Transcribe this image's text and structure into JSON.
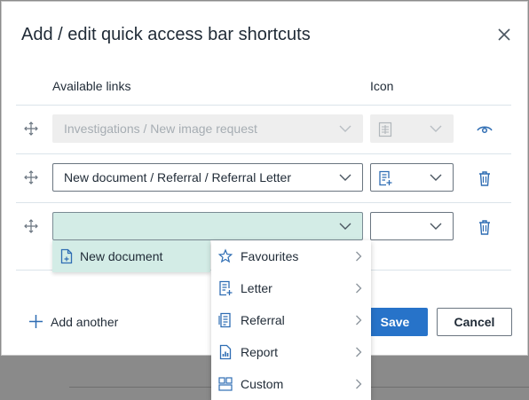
{
  "dialog": {
    "title": "Add / edit quick access bar shortcuts",
    "close_icon": "close-icon",
    "headers": {
      "links": "Available links",
      "icon": "Icon"
    }
  },
  "rows": [
    {
      "link": "Investigations / New image request",
      "icon": "image-request-icon",
      "disabled": true,
      "action": "eye-icon"
    },
    {
      "link": "New document / Referral / Referral Letter",
      "icon": "referral-letter-icon",
      "disabled": false,
      "action": "trash-icon"
    },
    {
      "link": "",
      "icon": "",
      "disabled": false,
      "action": "trash-icon"
    }
  ],
  "cascade": {
    "level1": {
      "label": "New document",
      "icon": "document-icon"
    },
    "level2": [
      {
        "label": "Favourites",
        "icon": "star-icon"
      },
      {
        "label": "Letter",
        "icon": "letter-icon"
      },
      {
        "label": "Referral",
        "icon": "referral-icon"
      },
      {
        "label": "Report",
        "icon": "report-icon"
      },
      {
        "label": "Custom",
        "icon": "custom-icon"
      }
    ]
  },
  "footer": {
    "add_another": "Add another",
    "save": "Save",
    "cancel": "Cancel"
  },
  "colors": {
    "accent": "#2773c9",
    "active_selection": "#d3ece6",
    "icon_blue": "#2f6db3"
  }
}
